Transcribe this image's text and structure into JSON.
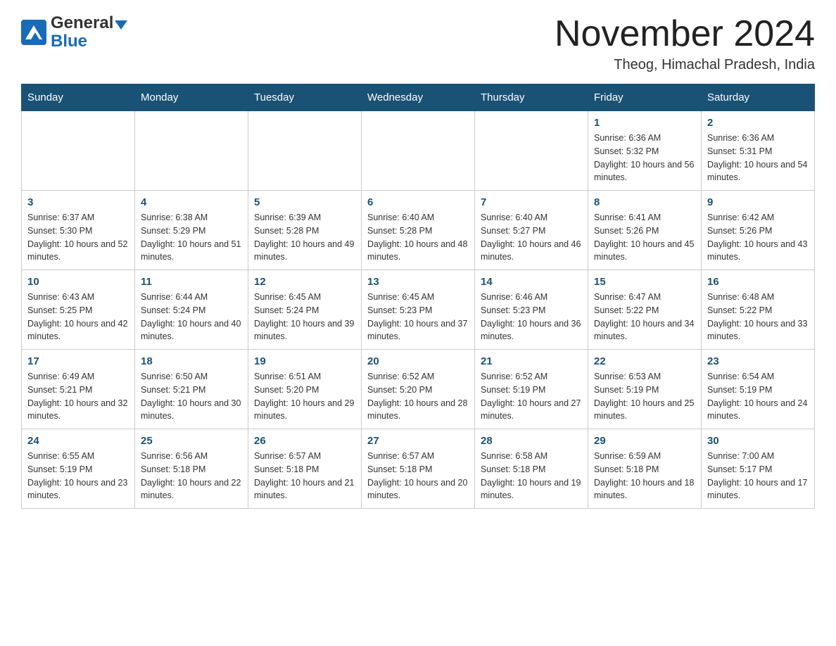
{
  "header": {
    "logo_general": "General",
    "logo_blue": "Blue",
    "title": "November 2024",
    "subtitle": "Theog, Himachal Pradesh, India"
  },
  "calendar": {
    "days_of_week": [
      "Sunday",
      "Monday",
      "Tuesday",
      "Wednesday",
      "Thursday",
      "Friday",
      "Saturday"
    ],
    "weeks": [
      [
        {
          "day": "",
          "info": ""
        },
        {
          "day": "",
          "info": ""
        },
        {
          "day": "",
          "info": ""
        },
        {
          "day": "",
          "info": ""
        },
        {
          "day": "",
          "info": ""
        },
        {
          "day": "1",
          "info": "Sunrise: 6:36 AM\nSunset: 5:32 PM\nDaylight: 10 hours and 56 minutes."
        },
        {
          "day": "2",
          "info": "Sunrise: 6:36 AM\nSunset: 5:31 PM\nDaylight: 10 hours and 54 minutes."
        }
      ],
      [
        {
          "day": "3",
          "info": "Sunrise: 6:37 AM\nSunset: 5:30 PM\nDaylight: 10 hours and 52 minutes."
        },
        {
          "day": "4",
          "info": "Sunrise: 6:38 AM\nSunset: 5:29 PM\nDaylight: 10 hours and 51 minutes."
        },
        {
          "day": "5",
          "info": "Sunrise: 6:39 AM\nSunset: 5:28 PM\nDaylight: 10 hours and 49 minutes."
        },
        {
          "day": "6",
          "info": "Sunrise: 6:40 AM\nSunset: 5:28 PM\nDaylight: 10 hours and 48 minutes."
        },
        {
          "day": "7",
          "info": "Sunrise: 6:40 AM\nSunset: 5:27 PM\nDaylight: 10 hours and 46 minutes."
        },
        {
          "day": "8",
          "info": "Sunrise: 6:41 AM\nSunset: 5:26 PM\nDaylight: 10 hours and 45 minutes."
        },
        {
          "day": "9",
          "info": "Sunrise: 6:42 AM\nSunset: 5:26 PM\nDaylight: 10 hours and 43 minutes."
        }
      ],
      [
        {
          "day": "10",
          "info": "Sunrise: 6:43 AM\nSunset: 5:25 PM\nDaylight: 10 hours and 42 minutes."
        },
        {
          "day": "11",
          "info": "Sunrise: 6:44 AM\nSunset: 5:24 PM\nDaylight: 10 hours and 40 minutes."
        },
        {
          "day": "12",
          "info": "Sunrise: 6:45 AM\nSunset: 5:24 PM\nDaylight: 10 hours and 39 minutes."
        },
        {
          "day": "13",
          "info": "Sunrise: 6:45 AM\nSunset: 5:23 PM\nDaylight: 10 hours and 37 minutes."
        },
        {
          "day": "14",
          "info": "Sunrise: 6:46 AM\nSunset: 5:23 PM\nDaylight: 10 hours and 36 minutes."
        },
        {
          "day": "15",
          "info": "Sunrise: 6:47 AM\nSunset: 5:22 PM\nDaylight: 10 hours and 34 minutes."
        },
        {
          "day": "16",
          "info": "Sunrise: 6:48 AM\nSunset: 5:22 PM\nDaylight: 10 hours and 33 minutes."
        }
      ],
      [
        {
          "day": "17",
          "info": "Sunrise: 6:49 AM\nSunset: 5:21 PM\nDaylight: 10 hours and 32 minutes."
        },
        {
          "day": "18",
          "info": "Sunrise: 6:50 AM\nSunset: 5:21 PM\nDaylight: 10 hours and 30 minutes."
        },
        {
          "day": "19",
          "info": "Sunrise: 6:51 AM\nSunset: 5:20 PM\nDaylight: 10 hours and 29 minutes."
        },
        {
          "day": "20",
          "info": "Sunrise: 6:52 AM\nSunset: 5:20 PM\nDaylight: 10 hours and 28 minutes."
        },
        {
          "day": "21",
          "info": "Sunrise: 6:52 AM\nSunset: 5:19 PM\nDaylight: 10 hours and 27 minutes."
        },
        {
          "day": "22",
          "info": "Sunrise: 6:53 AM\nSunset: 5:19 PM\nDaylight: 10 hours and 25 minutes."
        },
        {
          "day": "23",
          "info": "Sunrise: 6:54 AM\nSunset: 5:19 PM\nDaylight: 10 hours and 24 minutes."
        }
      ],
      [
        {
          "day": "24",
          "info": "Sunrise: 6:55 AM\nSunset: 5:19 PM\nDaylight: 10 hours and 23 minutes."
        },
        {
          "day": "25",
          "info": "Sunrise: 6:56 AM\nSunset: 5:18 PM\nDaylight: 10 hours and 22 minutes."
        },
        {
          "day": "26",
          "info": "Sunrise: 6:57 AM\nSunset: 5:18 PM\nDaylight: 10 hours and 21 minutes."
        },
        {
          "day": "27",
          "info": "Sunrise: 6:57 AM\nSunset: 5:18 PM\nDaylight: 10 hours and 20 minutes."
        },
        {
          "day": "28",
          "info": "Sunrise: 6:58 AM\nSunset: 5:18 PM\nDaylight: 10 hours and 19 minutes."
        },
        {
          "day": "29",
          "info": "Sunrise: 6:59 AM\nSunset: 5:18 PM\nDaylight: 10 hours and 18 minutes."
        },
        {
          "day": "30",
          "info": "Sunrise: 7:00 AM\nSunset: 5:17 PM\nDaylight: 10 hours and 17 minutes."
        }
      ]
    ]
  }
}
